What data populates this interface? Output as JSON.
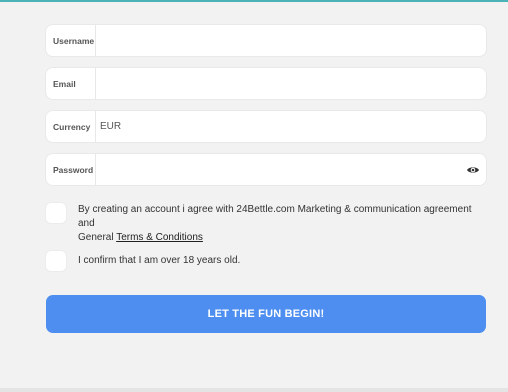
{
  "form": {
    "username": {
      "label": "Username",
      "value": ""
    },
    "email": {
      "label": "Email",
      "value": ""
    },
    "currency": {
      "label": "Currency",
      "value": "EUR"
    },
    "password": {
      "label": "Password",
      "value": ""
    }
  },
  "agreements": {
    "terms_text_1": "By creating an account i agree with 24Bettle.com Marketing & communication agreement and",
    "terms_text_2": "General ",
    "terms_link": "Terms & Conditions",
    "age_text": "I confirm that I am over 18 years old."
  },
  "cta": {
    "label": "LET THE FUN BEGIN!"
  },
  "icons": {
    "password_toggle": "eye-icon"
  },
  "colors": {
    "background": "#f2f2f2",
    "button": "#4d8ef0",
    "accent_top": "#4bb3b8"
  }
}
